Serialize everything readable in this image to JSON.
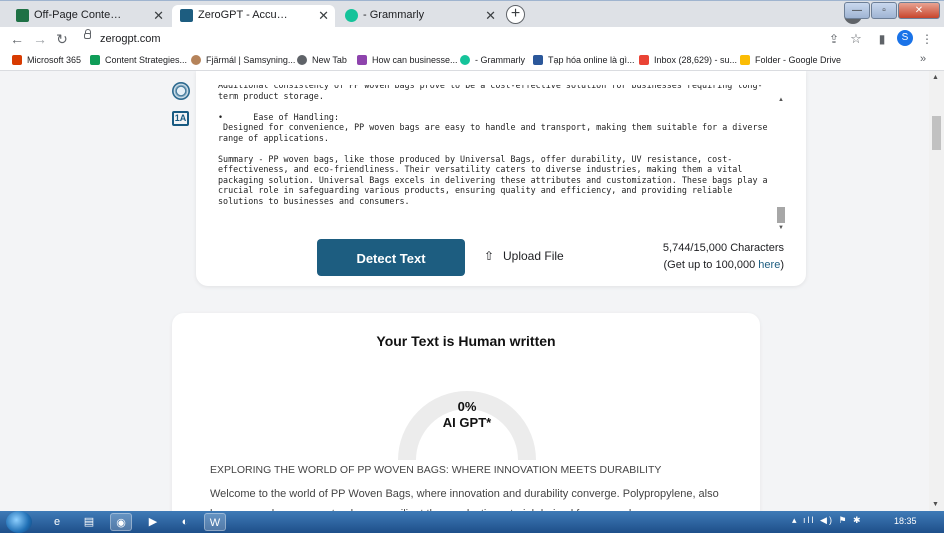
{
  "browser": {
    "tabs": [
      {
        "title": "Off-Page Content Requirement Sh",
        "favicon_color": "#1e7145",
        "favicon_icon": "excel-icon",
        "active": false
      },
      {
        "title": "ZeroGPT - Accurate Chat GPT, GPT",
        "favicon_color": "#1d5d80",
        "favicon_icon": "zerogpt-icon",
        "active": true
      },
      {
        "title": "- Grammarly",
        "favicon_color": "#15c39a",
        "favicon_icon": "grammarly-icon",
        "active": false
      }
    ],
    "close_glyph": "✕",
    "new_tab_glyph": "+",
    "address": "zerogpt.com",
    "avatar_letter": "S",
    "bookmarks": [
      {
        "label": "Microsoft 365",
        "color": "#d83b01"
      },
      {
        "label": "Content Strategies...",
        "color": "#0f9d58"
      },
      {
        "label": "Fjärmál | Samsyning...",
        "color": "#b5835a"
      },
      {
        "label": "New Tab",
        "color": "#5f6368"
      },
      {
        "label": "How can businesse...",
        "color": "#8e44ad"
      },
      {
        "label": "- Grammarly",
        "color": "#15c39a"
      },
      {
        "label": "Tạp hóa online là gì...",
        "color": "#2b579a"
      },
      {
        "label": "Inbox (28,629) - su...",
        "color": "#ea4335"
      },
      {
        "label": "Folder - Google Drive",
        "color": "#fbbc04"
      }
    ]
  },
  "editor": {
    "paragraphs": [
      "Additional consistency of PP woven bags prove to be a cost-effective solution for businesses requiring long-term product storage.",
      "•      Ease of Handling:\n Designed for convenience, PP woven bags are easy to handle and transport, making them suitable for a diverse range of applications.",
      "Summary - PP woven bags, like those produced by Universal Bags, offer durability, UV resistance, cost-effectiveness, and eco-friendliness. Their versatility caters to diverse industries, making them a vital packaging solution. Universal Bags excels in delivering these attributes and customization. These bags play a crucial role in safeguarding various products, ensuring quality and efficiency, and providing reliable solutions to businesses and consumers."
    ]
  },
  "actions": {
    "detect_label": "Detect Text",
    "upload_label": "Upload File",
    "char_count": "5,744/15,000 Characters",
    "upgrade_prefix": "(Get up to 100,000 ",
    "upgrade_link": "here",
    "upgrade_suffix": ")"
  },
  "result": {
    "title": "Your Text is Human written",
    "percent": "0%",
    "ai_percent_value": 0,
    "label": "AI GPT*",
    "heading": "EXPLORING THE WORLD OF PP WOVEN BAGS: WHERE INNOVATION MEETS DURABILITY",
    "body": "Welcome to the world of PP Woven Bags, where innovation and durability converge. Polypropylene, also known as polypropene, stands as a resilient thermoplastic material derived from propylene."
  },
  "taskbar": {
    "clock": "18:35"
  },
  "colors": {
    "accent": "#1d5d80",
    "gauge_track": "#ececec"
  }
}
